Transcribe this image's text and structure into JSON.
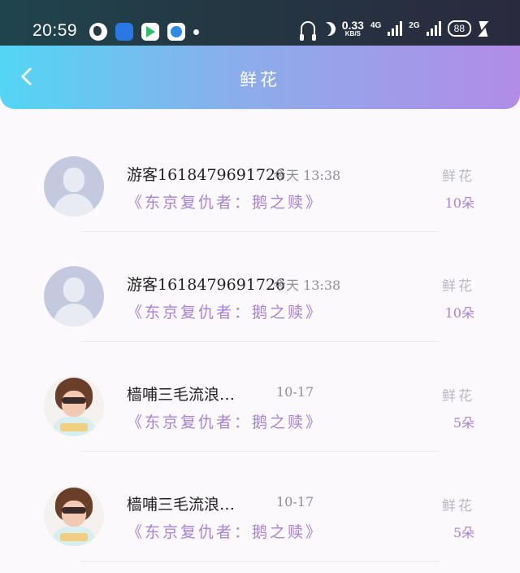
{
  "status_bar": {
    "time": "20:59",
    "net_speed_value": "0.33",
    "net_speed_unit": "KB/S",
    "network_1": "4G",
    "network_2": "2G",
    "battery": "88",
    "app_icons": [
      "globe-app-icon",
      "android-app-icon",
      "play-store-icon",
      "blue-circle-app-icon"
    ]
  },
  "header": {
    "title": "鲜花",
    "background_gradient": [
      "#53d6f5",
      "#8aaeeb",
      "#b28ce8"
    ]
  },
  "gift_list": [
    {
      "avatar": "default-avatar",
      "name": "游客1618479691726",
      "time": "今天 13:38",
      "work": "《东京复仇者：鹅之赎》",
      "gift": "鲜花",
      "count": "10朵"
    },
    {
      "avatar": "default-avatar",
      "name": "游客1618479691726",
      "time": "今天 13:38",
      "work": "《东京复仇者：鹅之赎》",
      "gift": "鲜花",
      "count": "10朵"
    },
    {
      "avatar": "photo-avatar",
      "name": "樯哺三毛流浪…",
      "time": "10-17",
      "work": "《东京复仇者：鹅之赎》",
      "gift": "鲜花",
      "count": "5朵"
    },
    {
      "avatar": "photo-avatar",
      "name": "樯哺三毛流浪…",
      "time": "10-17",
      "work": "《东京复仇者：鹅之赎》",
      "gift": "鲜花",
      "count": "5朵"
    }
  ],
  "colors": {
    "accent_purple": "#a782d8",
    "muted_gray": "#b9b9c4"
  }
}
